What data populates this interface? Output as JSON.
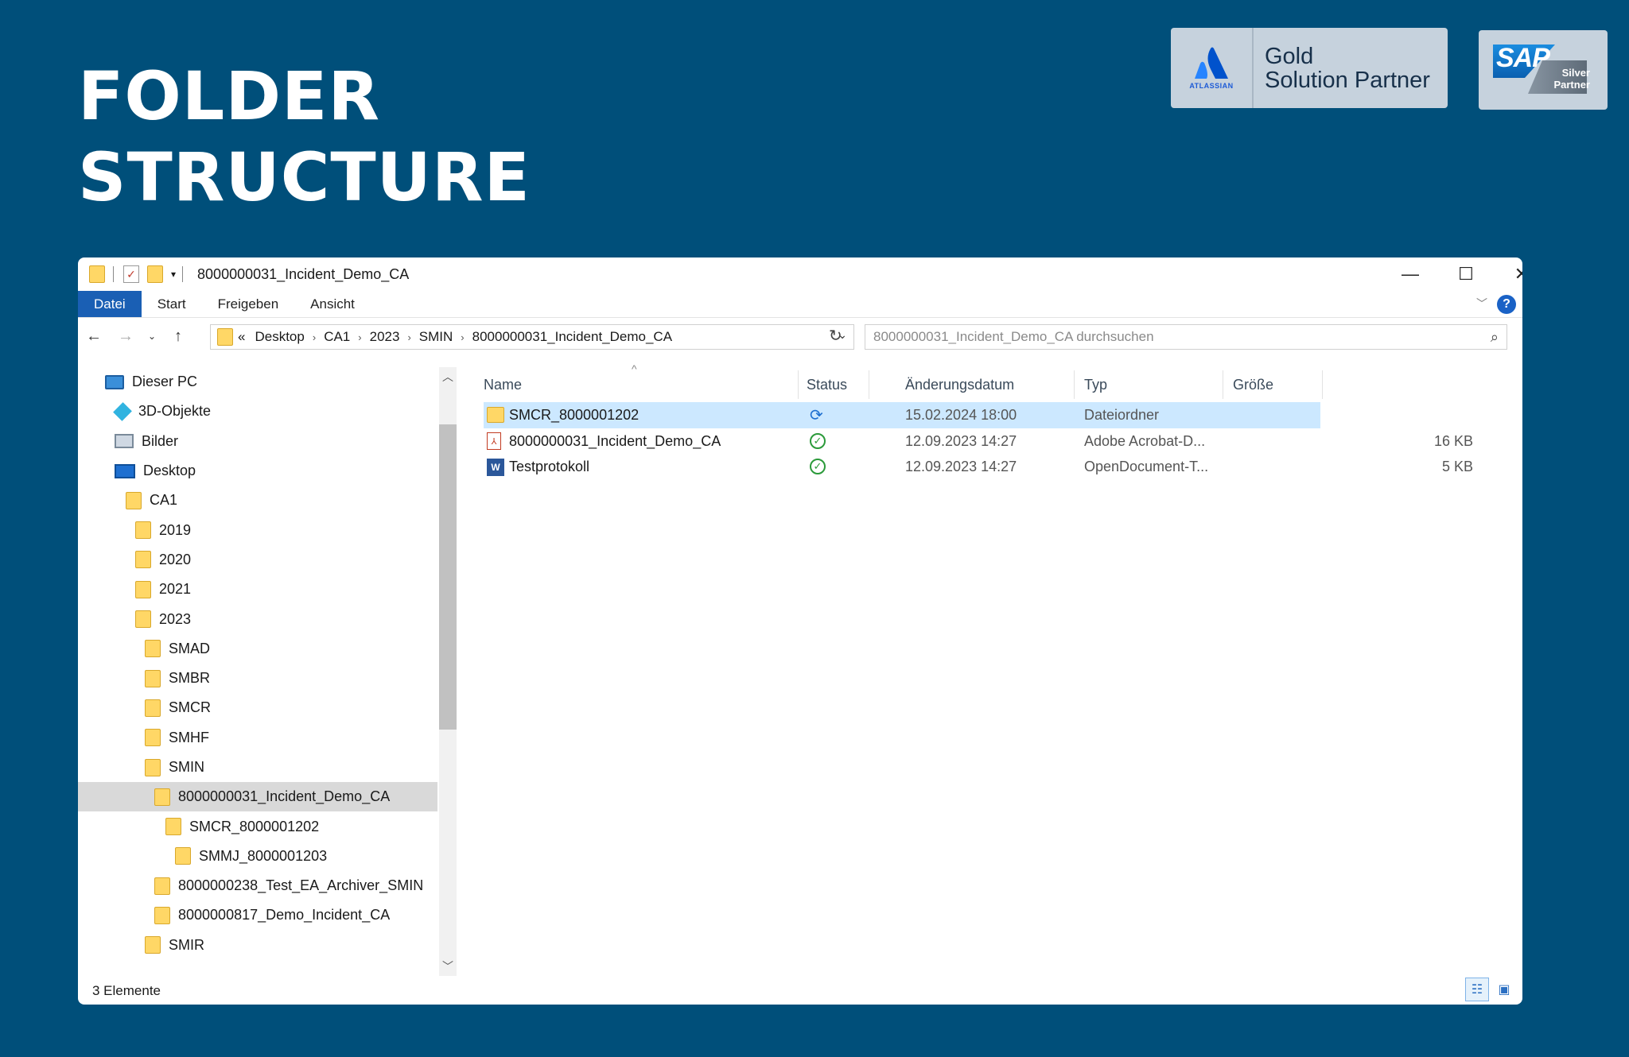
{
  "headline": {
    "line1": "FOLDER",
    "line2": "STRUCTURE"
  },
  "badges": {
    "atlassian": {
      "logo_text": "ATLASSIAN",
      "line1": "Gold",
      "line2": "Solution Partner"
    },
    "sap": {
      "logo_text": "SAP",
      "line1": "Silver",
      "line2": "Partner"
    }
  },
  "window": {
    "title": "8000000031_Incident_Demo_CA",
    "controls": {
      "minimize": "—",
      "maximize": "☐",
      "close": "✕"
    },
    "ribbon_tabs": [
      "Datei",
      "Start",
      "Freigeben",
      "Ansicht"
    ],
    "help_label": "?",
    "address": {
      "prefix": "«",
      "crumbs": [
        "Desktop",
        "CA1",
        "2023",
        "SMIN",
        "8000000031_Incident_Demo_CA"
      ]
    },
    "search_placeholder": "8000000031_Incident_Demo_CA durchsuchen",
    "tree": [
      {
        "label": "Dieser PC",
        "icon": "pc-icon",
        "indent": 0
      },
      {
        "label": "3D-Objekte",
        "icon": "cube-icon",
        "indent": 1
      },
      {
        "label": "Bilder",
        "icon": "pictures-icon",
        "indent": 1
      },
      {
        "label": "Desktop",
        "icon": "desktop-icon",
        "indent": 1
      },
      {
        "label": "CA1",
        "icon": "folder-icon",
        "indent": 2
      },
      {
        "label": "2019",
        "icon": "folder-icon",
        "indent": 3
      },
      {
        "label": "2020",
        "icon": "folder-icon",
        "indent": 3
      },
      {
        "label": "2021",
        "icon": "folder-icon",
        "indent": 3
      },
      {
        "label": "2023",
        "icon": "folder-icon",
        "indent": 3
      },
      {
        "label": "SMAD",
        "icon": "folder-icon",
        "indent": 4
      },
      {
        "label": "SMBR",
        "icon": "folder-icon",
        "indent": 4
      },
      {
        "label": "SMCR",
        "icon": "folder-icon",
        "indent": 4
      },
      {
        "label": "SMHF",
        "icon": "folder-icon",
        "indent": 4
      },
      {
        "label": "SMIN",
        "icon": "folder-icon",
        "indent": 4
      },
      {
        "label": "8000000031_Incident_Demo_CA",
        "icon": "folder-icon",
        "indent": 5,
        "selected": true
      },
      {
        "label": "SMCR_8000001202",
        "icon": "folder-icon",
        "indent": 6
      },
      {
        "label": "SMMJ_8000001203",
        "icon": "folder-icon",
        "indent": 7
      },
      {
        "label": "8000000238_Test_EA_Archiver_SMIN",
        "icon": "folder-icon",
        "indent": 5
      },
      {
        "label": "8000000817_Demo_Incident_CA",
        "icon": "folder-icon",
        "indent": 5
      },
      {
        "label": "SMIR",
        "icon": "folder-icon",
        "indent": 4
      }
    ],
    "columns": {
      "name": "Name",
      "status": "Status",
      "date": "Änderungsdatum",
      "type": "Typ",
      "size": "Größe"
    },
    "files": [
      {
        "name": "SMCR_8000001202",
        "icon": "folder-icon",
        "status": "sync-icon",
        "date": "15.02.2024 18:00",
        "type": "Dateiordner",
        "size": "",
        "selected": true
      },
      {
        "name": "8000000031_Incident_Demo_CA",
        "icon": "pdf-icon",
        "status": "check-icon",
        "date": "12.09.2023 14:27",
        "type": "Adobe Acrobat-D...",
        "size": "16 KB"
      },
      {
        "name": "Testprotokoll",
        "icon": "word-doc-icon",
        "status": "check-icon",
        "date": "12.09.2023 14:27",
        "type": "OpenDocument-T...",
        "size": "5 KB"
      }
    ],
    "status_bar": "3 Elemente",
    "colors": {
      "background": "#004f7a",
      "ribbon_active": "#1a5fb4",
      "selection": "#cce8ff",
      "folder": "#ffd766"
    }
  }
}
